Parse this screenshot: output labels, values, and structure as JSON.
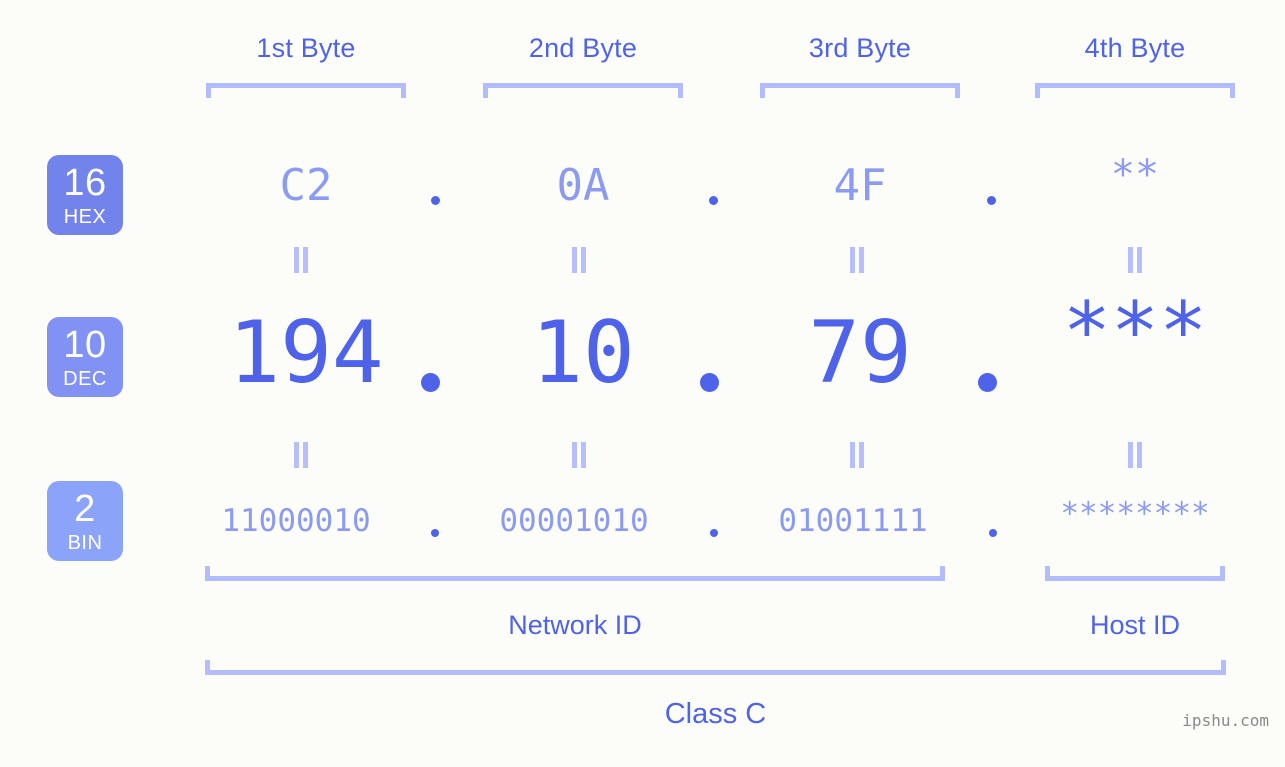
{
  "background_color": "#fcfdf8",
  "accent_color": "#4e63ea",
  "muted_accent_color": "#8c9bf2",
  "bracket_color": "#b4bdfb",
  "byte_headers": [
    {
      "label": "1st Byte"
    },
    {
      "label": "2nd Byte"
    },
    {
      "label": "3rd Byte"
    },
    {
      "label": "4th Byte"
    }
  ],
  "rows": {
    "hex": {
      "badge_number": "16",
      "badge_name": "HEX",
      "badge_color": "#7383ec",
      "values": [
        "C2",
        "0A",
        "4F",
        "**"
      ]
    },
    "dec": {
      "badge_number": "10",
      "badge_name": "DEC",
      "badge_color": "#8192f4",
      "values": [
        "194",
        "10",
        "79",
        "***"
      ]
    },
    "bin": {
      "badge_number": "2",
      "badge_name": "BIN",
      "badge_color": "#8ba3f9",
      "values": [
        "11000010",
        "00001010",
        "01001111",
        "********"
      ]
    }
  },
  "separator": ".",
  "equals_symbol": "=",
  "footer": {
    "network_id_label": "Network ID",
    "host_id_label": "Host ID",
    "class_label": "Class C"
  },
  "watermark": "ipshu.com"
}
